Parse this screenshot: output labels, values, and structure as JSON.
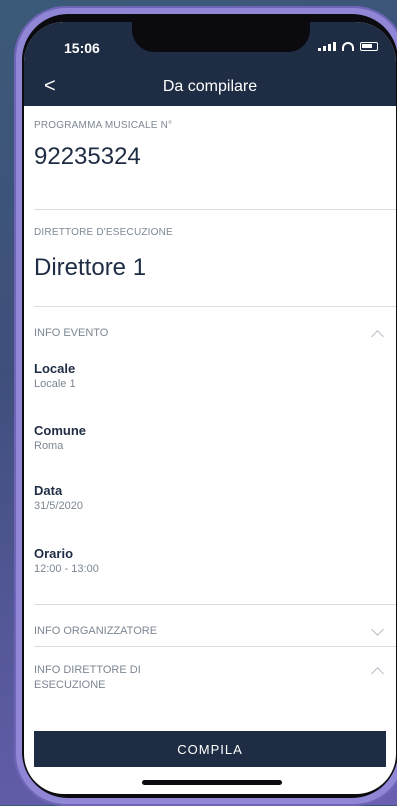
{
  "status_bar": {
    "time": "15:06"
  },
  "header": {
    "back": "<",
    "title": "Da compilare"
  },
  "fields": {
    "programma_label": "PROGRAMMA MUSICALE N°",
    "programma_value": "92235324",
    "direttore_label": "DIRETTORE D'ESECUZIONE",
    "direttore_value": "Direttore 1"
  },
  "sections": {
    "info_evento": "INFO EVENTO",
    "info_organizzatore": "INFO ORGANIZZATORE",
    "info_direttore_line1": "INFO DIRETTORE DI",
    "info_direttore_line2": "ESECUZIONE"
  },
  "event_info": {
    "locale_title": "Locale",
    "locale_value": "Locale 1",
    "comune_title": "Comune",
    "comune_value": "Roma",
    "data_title": "Data",
    "data_value": "31/5/2020",
    "orario_title": "Orario",
    "orario_value": "12:00 - 13:00"
  },
  "actions": {
    "compila": "COMPILA"
  },
  "colors": {
    "header_bg": "#1f2d44",
    "label": "#7c8793",
    "value": "#1f2d44",
    "phone_frame": "#8f86d6"
  }
}
